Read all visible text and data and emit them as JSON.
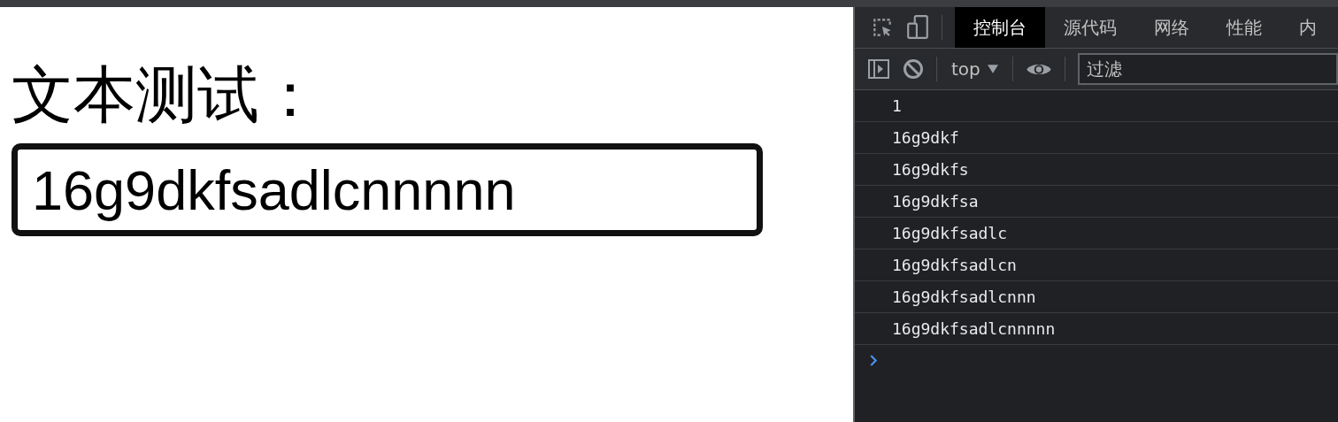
{
  "page": {
    "heading": "文本测试：",
    "input": {
      "value": "16g9dkfsadlcnnnnn"
    }
  },
  "devtools": {
    "tabs": [
      {
        "label": "控制台",
        "selected": true
      },
      {
        "label": "源代码",
        "selected": false
      },
      {
        "label": "网络",
        "selected": false
      },
      {
        "label": "性能",
        "selected": false
      },
      {
        "label": "内",
        "selected": false
      }
    ],
    "toolbar": {
      "context": "top",
      "filter": {
        "placeholder": "过滤"
      }
    },
    "console": {
      "messages": [
        "1",
        "16g9dkf",
        "16g9dkfs",
        "16g9dkfsa",
        "16g9dkfsadlc",
        "16g9dkfsadlcn",
        "16g9dkfsadlcnnn",
        "16g9dkfsadlcnnnnn"
      ]
    }
  }
}
